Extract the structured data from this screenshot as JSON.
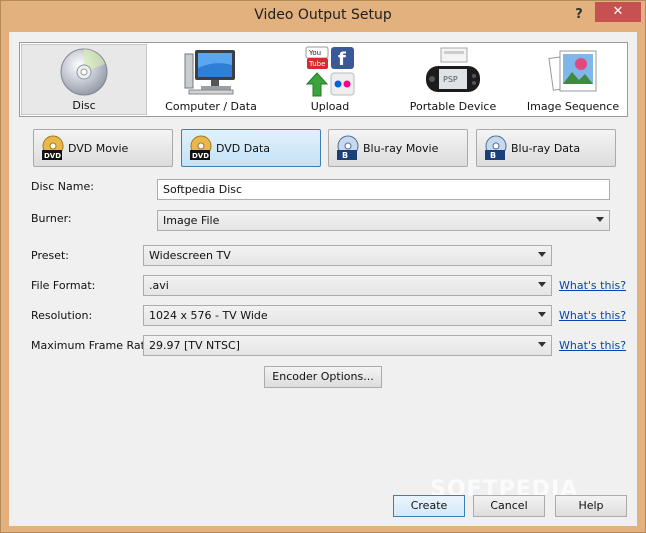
{
  "window": {
    "title": "Video Output Setup",
    "help_glyph": "?",
    "close_glyph": "✕"
  },
  "categories": [
    {
      "label": "Disc",
      "icon": "disc-icon",
      "selected": true
    },
    {
      "label": "Computer / Data",
      "icon": "computer-icon",
      "selected": false
    },
    {
      "label": "Upload",
      "icon": "upload-icon",
      "selected": false
    },
    {
      "label": "Portable Device",
      "icon": "portable-device-icon",
      "selected": false
    },
    {
      "label": "Image Sequence",
      "icon": "image-sequence-icon",
      "selected": false
    }
  ],
  "formats": [
    {
      "label": "DVD Movie",
      "icon": "dvd-icon",
      "selected": false
    },
    {
      "label": "DVD Data",
      "icon": "dvd-icon",
      "selected": true
    },
    {
      "label": "Blu-ray Movie",
      "icon": "bluray-icon",
      "selected": false
    },
    {
      "label": "Blu-ray Data",
      "icon": "bluray-icon",
      "selected": false
    }
  ],
  "form": {
    "disc_name_label": "Disc Name:",
    "disc_name_value": "Softpedia Disc",
    "burner_label": "Burner:",
    "burner_value": "Image File",
    "preset_label": "Preset:",
    "preset_value": "Widescreen TV",
    "file_format_label": "File Format:",
    "file_format_value": ".avi",
    "resolution_label": "Resolution:",
    "resolution_value": "1024 x 576 - TV Wide",
    "frame_rate_label": "Maximum Frame Rate:",
    "frame_rate_value": "29.97 [TV NTSC]",
    "whats_this": "What's this?"
  },
  "buttons": {
    "encoder_options": "Encoder Options...",
    "create": "Create",
    "cancel": "Cancel",
    "help": "Help"
  },
  "watermark": "SOFTPEDIA",
  "colors": {
    "accent": "#3c7fb1",
    "link": "#0645ad",
    "close": "#c75050"
  }
}
